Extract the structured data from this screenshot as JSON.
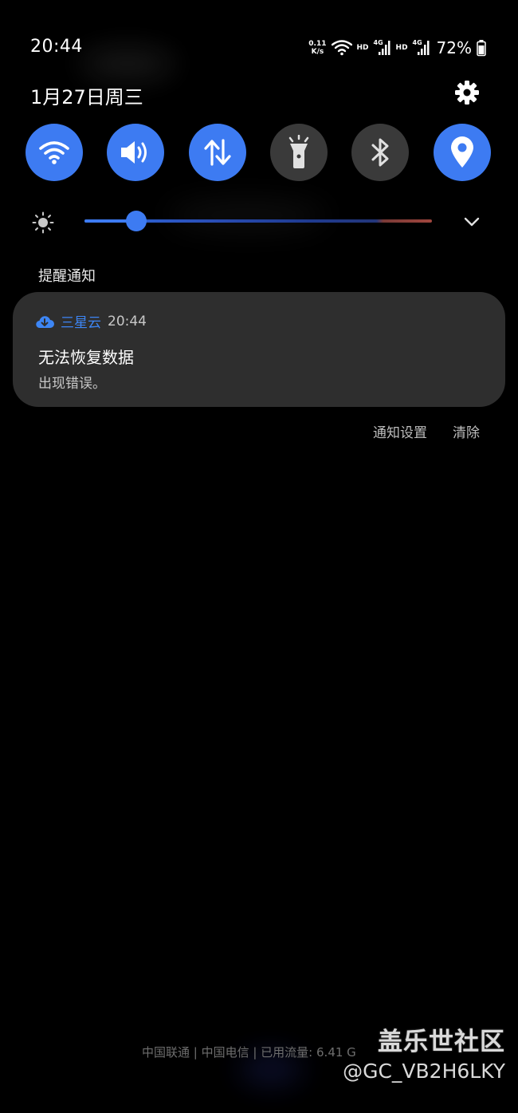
{
  "status_bar": {
    "time": "20:44",
    "net_speed_value": "0.11",
    "net_speed_unit": "K/s",
    "hd1": "HD",
    "net1": "4G",
    "hd2": "HD",
    "net2": "4G",
    "battery_percent": "72%"
  },
  "header": {
    "date": "1月27日周三"
  },
  "quick_toggles": [
    {
      "name": "wifi",
      "state": "on",
      "icon": "wifi-icon"
    },
    {
      "name": "sound",
      "state": "on",
      "icon": "speaker-icon"
    },
    {
      "name": "mobile-data",
      "state": "on",
      "icon": "data-arrows-icon"
    },
    {
      "name": "flashlight",
      "state": "off",
      "icon": "flashlight-icon"
    },
    {
      "name": "bluetooth",
      "state": "off",
      "icon": "bluetooth-icon"
    },
    {
      "name": "location",
      "state": "on",
      "icon": "location-pin-icon"
    }
  ],
  "brightness": {
    "level": 0.15
  },
  "notifications": {
    "section_label": "提醒通知",
    "items": [
      {
        "app_name": "三星云",
        "time": "20:44",
        "title": "无法恢复数据",
        "body": "出现错误。"
      }
    ],
    "settings_label": "通知设置",
    "clear_label": "清除"
  },
  "footer": {
    "carrier_info": "中国联通 | 中国电信 | 已用流量: 6.41 G"
  },
  "watermark": {
    "line1": "盖乐世社区",
    "line2": "@GC_VB2H6LKY"
  },
  "colors": {
    "accent": "#3d7bf2",
    "toggle_off": "#3a3a3a",
    "card_bg": "#2e2e2e",
    "app_name": "#3d86f5"
  }
}
